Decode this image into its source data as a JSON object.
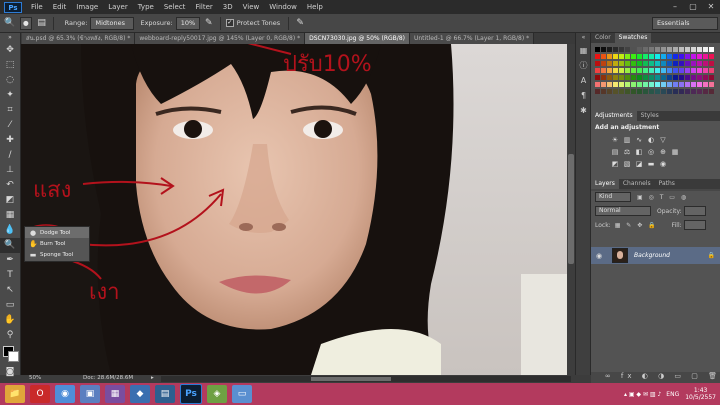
{
  "app": {
    "logo": "Ps"
  },
  "menu": [
    "File",
    "Edit",
    "Image",
    "Layer",
    "Type",
    "Select",
    "Filter",
    "3D",
    "View",
    "Window",
    "Help"
  ],
  "options": {
    "range_label": "Range:",
    "range_value": "Midtones",
    "exposure_label": "Exposure:",
    "exposure_value": "10%",
    "protect_tones": "Protect Tones",
    "workspace": "Essentials"
  },
  "tabs": [
    {
      "label": "ส่น.psd @ 65.3% (ข้างหลัง, RGB/8) *",
      "active": false
    },
    {
      "label": "webboard-reply50017.jpg @ 145% (Layer 0, RGB/8) *",
      "active": false
    },
    {
      "label": "DSCN73030.jpg @ 50% (RGB/8)",
      "active": true
    },
    {
      "label": "Untitled-1 @ 66.7% (Layer 1, RGB/8) *",
      "active": false
    }
  ],
  "flyout": {
    "items": [
      "Dodge Tool",
      "Burn Tool",
      "Sponge Tool"
    ]
  },
  "annotations": {
    "top": "ปรับ10%",
    "left": "แสง",
    "bottom": "เงา"
  },
  "panels": {
    "color_tab": "Color",
    "swatches_tab": "Swatches",
    "adjustments_tab": "Adjustments",
    "styles_tab": "Styles",
    "adjust_title": "Add an adjustment",
    "layers_tab": "Layers",
    "channels_tab": "Channels",
    "paths_tab": "Paths",
    "kind": "Kind",
    "blend": "Normal",
    "opacity_label": "Opacity:",
    "lock_label": "Lock:",
    "fill_label": "Fill:",
    "layer_name": "Background"
  },
  "status": {
    "zoom": "50%",
    "doc": "Doc: 28.6M/28.6M"
  },
  "taskbar": {
    "lang": "ENG",
    "time": "1:43",
    "date": "10/5/2557"
  },
  "colors": {
    "accent": "#b33a5e",
    "annotation": "#b3121c",
    "selection": "#5b6b86"
  }
}
